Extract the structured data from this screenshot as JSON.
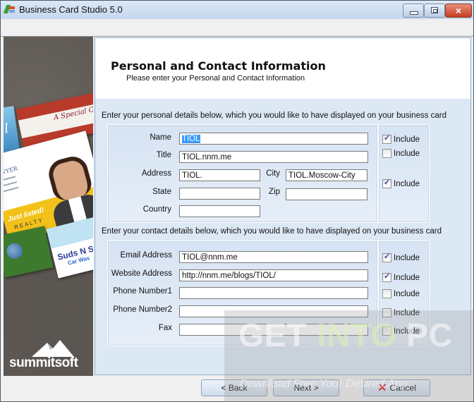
{
  "window": {
    "title": "Business Card Studio 5.0",
    "controls": {
      "minimize": "minimize",
      "maximize": "maximize",
      "close": "×"
    }
  },
  "sidebar": {
    "logo_text": "summitsoft",
    "sample_cards": {
      "script_card": "A Special O",
      "blue_card": "el",
      "realtor_name": "DWYER",
      "realtor_tagline": "Just listed!",
      "realtor_company": "REALTY",
      "carwash_title": "Suds N St",
      "carwash_subtitle": "Car Was"
    }
  },
  "header": {
    "title": "Personal and Contact Information",
    "subtitle": "Please enter your Personal and Contact Information"
  },
  "personal": {
    "instructions": "Enter your personal details below, which you would like to have displayed on your business card",
    "fields": {
      "name": {
        "label": "Name",
        "value": "TIOL"
      },
      "title": {
        "label": "Title",
        "value": "TIOL.nnm.me"
      },
      "address": {
        "label": "Address",
        "value": "TIOL."
      },
      "city": {
        "label": "City",
        "value": "TIOL.Moscow-City"
      },
      "state": {
        "label": "State",
        "value": ""
      },
      "zip": {
        "label": "Zip",
        "value": ""
      },
      "country": {
        "label": "Country",
        "value": ""
      }
    },
    "includes": [
      {
        "label": "Include",
        "checked": true
      },
      {
        "label": "Include",
        "checked": false
      },
      {
        "label": "Include",
        "checked": true
      }
    ]
  },
  "contact": {
    "instructions": "Enter your contact details below, which you would like to have displayed on your business card",
    "fields": [
      {
        "label": "Email Address",
        "value": "TIOL@nnm.me",
        "include_label": "Include",
        "include_checked": true
      },
      {
        "label": "Website Address",
        "value": "http://nnm.me/blogs/TIOL/",
        "include_label": "Include",
        "include_checked": true
      },
      {
        "label": "Phone Number1",
        "value": "",
        "include_label": "Include",
        "include_checked": false
      },
      {
        "label": "Phone Number2",
        "value": "",
        "include_label": "Include",
        "include_checked": false
      },
      {
        "label": "Fax",
        "value": "",
        "include_label": "Include",
        "include_checked": false
      }
    ]
  },
  "footer": {
    "back_label": "< Back",
    "next_label": "Next >",
    "cancel_label": "Cancel"
  },
  "watermark": {
    "line1_a": "GET ",
    "line1_b": "INTO",
    "line1_c": " PC",
    "line2": "Download Free Your Desired App"
  },
  "colors": {
    "accent": "#3399ff",
    "content_bg": "#dde8f5",
    "check": "#3a4a9a",
    "cancel_icon": "#d42020"
  }
}
